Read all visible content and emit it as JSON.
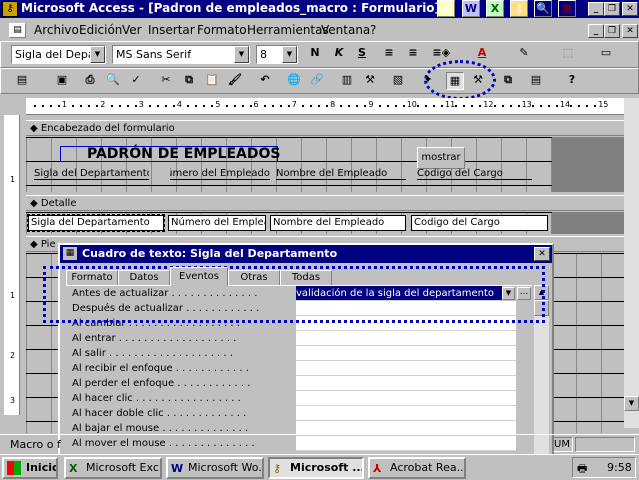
{
  "app": {
    "title": "Microsoft Access - [Padron de empleados_macro : Formulario]"
  },
  "menu": {
    "items": [
      "Archivo",
      "Edición",
      "Ver",
      "Insertar",
      "Formato",
      "Herramientas",
      "Ventana",
      "?"
    ]
  },
  "format_bar": {
    "object_value": "Sigla del Depart",
    "font_value": "MS Sans Serif",
    "size_value": "8"
  },
  "ruler": {
    "ticks": [
      "1",
      "2",
      "3",
      "4",
      "5",
      "6",
      "7",
      "8",
      "9",
      "10",
      "11",
      "12",
      "13",
      "14",
      "15"
    ]
  },
  "form": {
    "header_section": "Encabezado del formulario",
    "title_label": "PADRÓN DE EMPLEADOS",
    "button_label": "mostrar",
    "header_columns": [
      "Sigla del Departamento",
      "Número del Empleado",
      "Nombre del Empleado",
      "Codigo del Cargo"
    ],
    "detail_section": "Detalle",
    "detail_fields": [
      "Sigla del Departamento",
      "Número del Emplea",
      "Nombre del Empleado",
      "Codigo del Cargo"
    ],
    "footer_section": "Pie"
  },
  "props": {
    "title": "Cuadro de texto: Sigla del Departamento",
    "tabs": [
      "Formato",
      "Datos",
      "Eventos",
      "Otras",
      "Todas"
    ],
    "active_tab": "Eventos",
    "rows": [
      {
        "label": "Antes de actualizar . . . . . . . . . . . . . .",
        "value": "validación de la sigla del departamento"
      },
      {
        "label": "Después de actualizar . . . . . . . . . . . .",
        "value": ""
      },
      {
        "label": "Al cambiar . . . . . . . . . . . . . . . . . .",
        "value": ""
      },
      {
        "label": "Al entrar . . . . . . . . . . . . . . . . . . .",
        "value": ""
      },
      {
        "label": "Al salir . . . . . . . . . . . . . . . . . . . .",
        "value": ""
      },
      {
        "label": "Al recibir el enfoque . . . . . . . . . . . .",
        "value": ""
      },
      {
        "label": "Al perder el enfoque . . . . . . . . . . . .",
        "value": ""
      },
      {
        "label": "Al hacer clic . . . . . . . . . . . . . . . . .",
        "value": ""
      },
      {
        "label": "Al hacer doble clic . . . . . . . . . . . . .",
        "value": ""
      },
      {
        "label": "Al bajar el mouse . . . . . . . . . . . . . .",
        "value": ""
      },
      {
        "label": "Al mover el mouse . . . . . . . . . . . . . .",
        "value": ""
      }
    ]
  },
  "status": {
    "left": "Macro o f",
    "right": "UM"
  },
  "taskbar": {
    "start": "Inicio",
    "tasks": [
      "Microsoft Exc...",
      "Microsoft Wo...",
      "Microsoft ...",
      "Acrobat Rea..."
    ],
    "clock": "9:58"
  },
  "colors": {
    "title_bg": "#000080",
    "face": "#c0c0c0",
    "highlight": "#0000c0"
  }
}
